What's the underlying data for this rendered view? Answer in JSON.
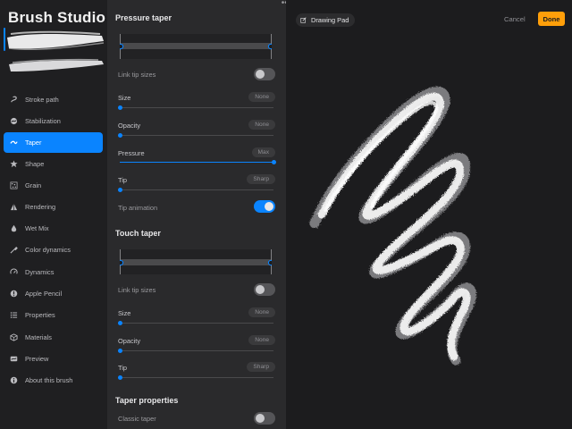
{
  "app": {
    "title": "Brush Studio"
  },
  "sidebar": {
    "items": [
      {
        "label": "Stroke path",
        "icon": "stroke-path-icon"
      },
      {
        "label": "Stabilization",
        "icon": "stabilization-icon"
      },
      {
        "label": "Taper",
        "icon": "taper-icon",
        "active": true
      },
      {
        "label": "Shape",
        "icon": "shape-icon"
      },
      {
        "label": "Grain",
        "icon": "grain-icon"
      },
      {
        "label": "Rendering",
        "icon": "rendering-icon"
      },
      {
        "label": "Wet Mix",
        "icon": "wet-mix-icon"
      },
      {
        "label": "Color dynamics",
        "icon": "color-dynamics-icon"
      },
      {
        "label": "Dynamics",
        "icon": "dynamics-icon"
      },
      {
        "label": "Apple Pencil",
        "icon": "apple-pencil-icon"
      },
      {
        "label": "Properties",
        "icon": "properties-icon"
      },
      {
        "label": "Materials",
        "icon": "materials-icon"
      },
      {
        "label": "Preview",
        "icon": "preview-icon"
      },
      {
        "label": "About this brush",
        "icon": "info-icon"
      }
    ]
  },
  "pressure_taper": {
    "title": "Pressure taper",
    "link_tip_sizes": {
      "label": "Link tip sizes",
      "on": false
    },
    "size": {
      "label": "Size",
      "value": "None",
      "level": 0
    },
    "opacity": {
      "label": "Opacity",
      "value": "None",
      "level": 0
    },
    "pressure": {
      "label": "Pressure",
      "value": "Max",
      "level": 1
    },
    "tip": {
      "label": "Tip",
      "value": "Sharp",
      "level": 0
    },
    "tip_animation": {
      "label": "Tip animation",
      "on": true
    }
  },
  "touch_taper": {
    "title": "Touch taper",
    "link_tip_sizes": {
      "label": "Link tip sizes",
      "on": false
    },
    "size": {
      "label": "Size",
      "value": "None",
      "level": 0
    },
    "opacity": {
      "label": "Opacity",
      "value": "None",
      "level": 0
    },
    "tip": {
      "label": "Tip",
      "value": "Sharp",
      "level": 0
    }
  },
  "taper_properties": {
    "title": "Taper properties",
    "classic_taper": {
      "label": "Classic taper",
      "on": false
    }
  },
  "drawing_pad": {
    "label": "Drawing Pad",
    "cancel_label": "Cancel",
    "done_label": "Done"
  },
  "colors": {
    "accent": "#0a84ff",
    "done": "#ff9f0a",
    "sidebar_bg": "#1f1f21",
    "panel_bg": "#2a2a2c",
    "canvas_bg": "#1c1c1e"
  }
}
